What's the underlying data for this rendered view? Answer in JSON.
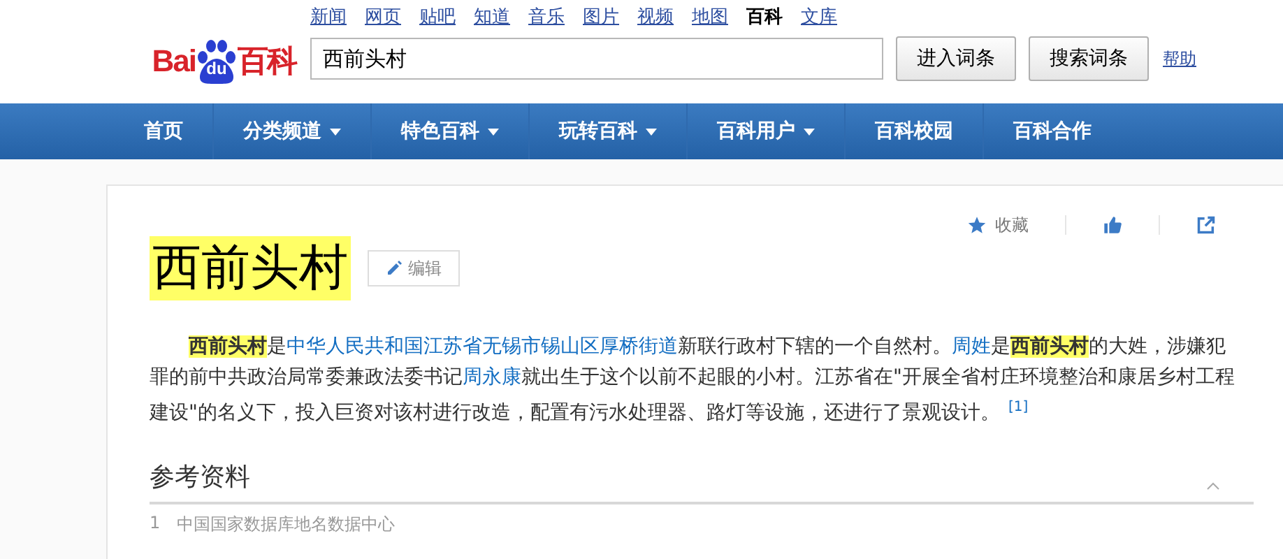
{
  "logo": {
    "part_1": "Bai",
    "part_2": "du",
    "part_3": "百科"
  },
  "top_links": [
    {
      "label": "新闻",
      "selected": false
    },
    {
      "label": "网页",
      "selected": false
    },
    {
      "label": "贴吧",
      "selected": false
    },
    {
      "label": "知道",
      "selected": false
    },
    {
      "label": "音乐",
      "selected": false
    },
    {
      "label": "图片",
      "selected": false
    },
    {
      "label": "视频",
      "selected": false
    },
    {
      "label": "地图",
      "selected": false
    },
    {
      "label": "百科",
      "selected": true
    },
    {
      "label": "文库",
      "selected": false
    }
  ],
  "search": {
    "value": "西前头村",
    "buttons": [
      "进入词条",
      "搜索词条"
    ],
    "help": "帮助"
  },
  "nav": [
    {
      "label": "首页",
      "dropdown": false
    },
    {
      "label": "分类频道",
      "dropdown": true
    },
    {
      "label": "特色百科",
      "dropdown": true
    },
    {
      "label": "玩转百科",
      "dropdown": true
    },
    {
      "label": "百科用户",
      "dropdown": true
    },
    {
      "label": "百科校园",
      "dropdown": false
    },
    {
      "label": "百科合作",
      "dropdown": false
    }
  ],
  "article": {
    "title": "西前头村",
    "edit": "编辑",
    "actions": [
      {
        "kind": "star",
        "label": "收藏"
      },
      {
        "kind": "like"
      },
      {
        "kind": "share"
      }
    ],
    "paragraph": [
      {
        "kind": "term",
        "text": "西前头村"
      },
      {
        "kind": "plain",
        "text": "是"
      },
      {
        "kind": "link",
        "text": "中华人民共和国"
      },
      {
        "kind": "link",
        "text": "江苏省"
      },
      {
        "kind": "link",
        "text": "无锡市"
      },
      {
        "kind": "link",
        "text": "锡山区"
      },
      {
        "kind": "link",
        "text": "厚桥街道"
      },
      {
        "kind": "plain",
        "text": "新联行政村下辖的一个自然村。"
      },
      {
        "kind": "link",
        "text": "周姓"
      },
      {
        "kind": "plain",
        "text": "是"
      },
      {
        "kind": "term",
        "text": "西前头村"
      },
      {
        "kind": "plain",
        "text": "的大姓，涉嫌犯罪的前中共政治局常委兼政法委书记"
      },
      {
        "kind": "link",
        "text": "周永康"
      },
      {
        "kind": "plain",
        "text": "就出生于这个以前不起眼的小村。江苏省在\"开展全省村庄环境整治和康居乡村工程建设\"的名义下，投入巨资对该村进行改造，配置有污水处理器、路灯等设施，还进行了景观设计。"
      },
      {
        "kind": "ref",
        "text": "[1]"
      }
    ]
  },
  "references": {
    "heading": "参考资料",
    "expanded": true,
    "items": [
      {
        "number": "1",
        "title": "中国国家数据库地名数据中心"
      }
    ]
  }
}
